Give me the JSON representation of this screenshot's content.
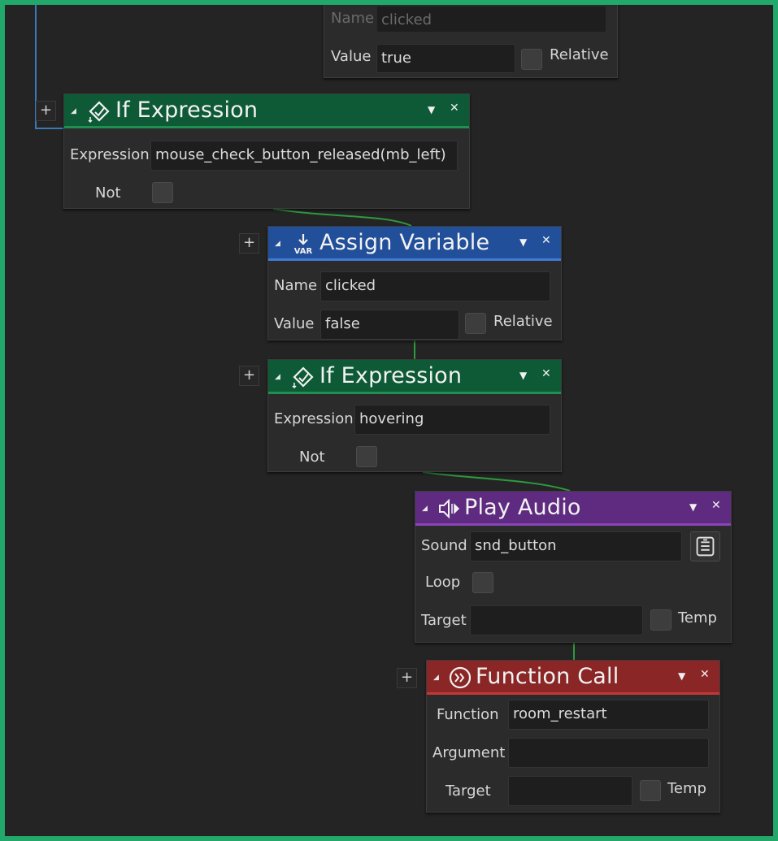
{
  "partial_block": {
    "name_label": "Name",
    "name_value": "clicked",
    "value_label": "Value",
    "value_value": "true",
    "relative_label": "Relative"
  },
  "if_expression_1": {
    "title": "If Expression",
    "expression_label": "Expression",
    "expression_value": "mouse_check_button_released(mb_left)",
    "not_label": "Not"
  },
  "assign_variable": {
    "title": "Assign Variable",
    "name_label": "Name",
    "name_value": "clicked",
    "value_label": "Value",
    "value_value": "false",
    "relative_label": "Relative"
  },
  "if_expression_2": {
    "title": "If Expression",
    "expression_label": "Expression",
    "expression_value": "hovering",
    "not_label": "Not"
  },
  "play_audio": {
    "title": "Play Audio",
    "sound_label": "Sound",
    "sound_value": "snd_button",
    "loop_label": "Loop",
    "target_label": "Target",
    "target_value": "",
    "temp_label": "Temp"
  },
  "function_call": {
    "title": "Function Call",
    "function_label": "Function",
    "function_value": "room_restart",
    "argument_label": "Argument",
    "argument_value": "",
    "target_label": "Target",
    "target_value": "",
    "temp_label": "Temp"
  },
  "ui": {
    "plus": "+",
    "collapse": "◢",
    "dropdown": "▼",
    "close": "✕"
  },
  "colors": {
    "border_accent": "#21a86a",
    "canvas": "#242424",
    "if_header": "#0e5a36",
    "assign_header": "#224f9a",
    "audio_header": "#5e2b80",
    "function_header": "#8a2626",
    "connector_green": "#2e9a3e",
    "connector_blue": "#3a78b8"
  },
  "icons": {
    "if_expression": "if-expression-icon",
    "assign_variable": "var-assign-icon",
    "play_audio": "speaker-icon",
    "function_call": "function-call-icon",
    "sound_browse": "asset-browse-icon"
  }
}
